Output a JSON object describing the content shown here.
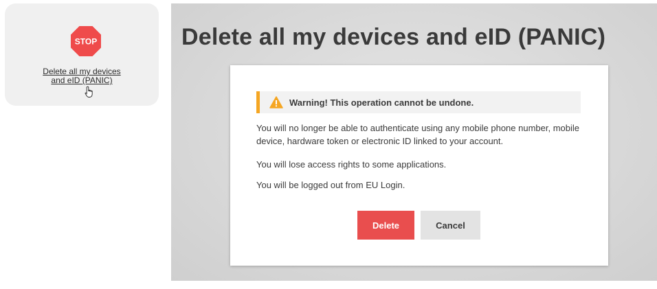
{
  "panic_card": {
    "stop_sign_text": "STOP",
    "link_line1": "Delete all my devices",
    "link_line2": "and eID (PANIC)"
  },
  "dialog_page": {
    "title": "Delete all my devices and eID (PANIC)",
    "warning": "Warning! This operation cannot be undone.",
    "paragraphs": [
      "You will no longer be able to authenticate using any mobile phone number, mobile device, hardware token or electronic ID linked to your account.",
      "You will lose access rights to some applications.",
      "You will be logged out from EU Login."
    ],
    "delete_label": "Delete",
    "cancel_label": "Cancel"
  },
  "colors": {
    "stop_red": "#ef4b4b",
    "warning_orange": "#f5a623",
    "delete_red": "#e94e4e",
    "cancel_gray": "#e3e3e3"
  },
  "icons": {
    "stop": "stop-sign-icon",
    "warning": "warning-triangle-icon",
    "cursor": "hand-pointer-icon"
  }
}
